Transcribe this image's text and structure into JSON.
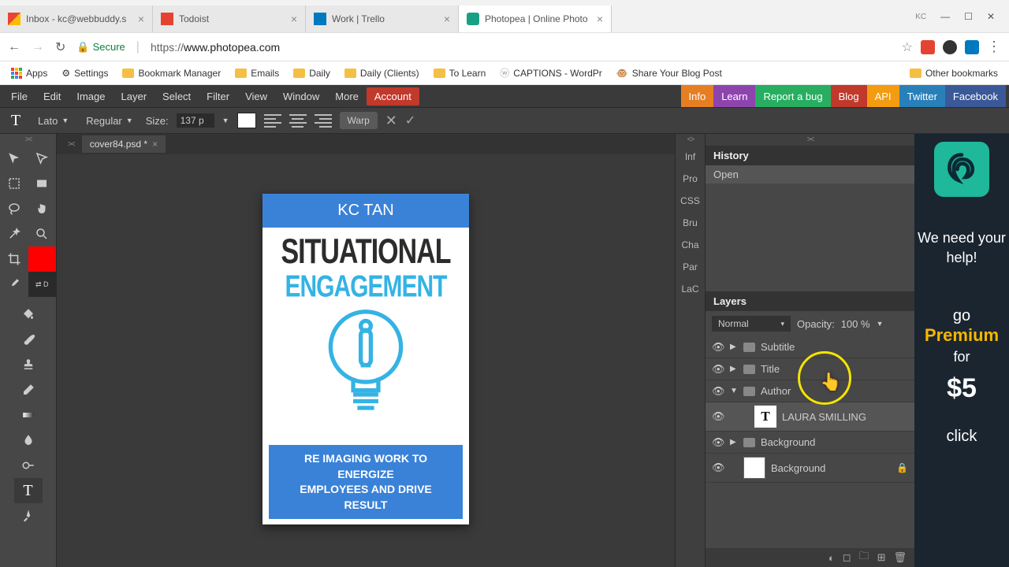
{
  "browser": {
    "tabs": [
      {
        "label": "Inbox - kc@webbuddy.s"
      },
      {
        "label": "Todoist"
      },
      {
        "label": "Work | Trello"
      },
      {
        "label": "Photopea | Online Photo"
      }
    ],
    "secure_label": "Secure",
    "url_prefix": "https://",
    "url_domain": "www.photopea.com",
    "user_badge": "KC"
  },
  "bookmarks": {
    "apps": "Apps",
    "settings": "Settings",
    "items": [
      "Bookmark Manager",
      "Emails",
      "Daily",
      "Daily (Clients)",
      "To Learn",
      "CAPTIONS - WordPr",
      "Share Your Blog Post"
    ],
    "other": "Other bookmarks"
  },
  "menubar": {
    "items": [
      "File",
      "Edit",
      "Image",
      "Layer",
      "Select",
      "Filter",
      "View",
      "Window",
      "More"
    ],
    "account": "Account",
    "right": [
      {
        "label": "Info",
        "bg": "#e67e22"
      },
      {
        "label": "Learn",
        "bg": "#8e44ad"
      },
      {
        "label": "Report a bug",
        "bg": "#27ae60"
      },
      {
        "label": "Blog",
        "bg": "#c0392b"
      },
      {
        "label": "API",
        "bg": "#f39c12"
      },
      {
        "label": "Twitter",
        "bg": "#2980b9"
      },
      {
        "label": "Facebook",
        "bg": "#34495e"
      }
    ]
  },
  "options": {
    "font": "Lato",
    "weight": "Regular",
    "size_label": "Size:",
    "size_value": "137 p",
    "warp": "Warp"
  },
  "doc_tab": "cover84.psd *",
  "book": {
    "author_top": "KC TAN",
    "title_l1": "SITUATIONAL",
    "title_l2": "ENGAGEMENT",
    "subtitle_l1": "RE IMAGING WORK TO ENERGIZE",
    "subtitle_l2": "EMPLOYEES AND DRIVE RESULT"
  },
  "side_tabs": [
    "Inf",
    "Pro",
    "CSS",
    "Bru",
    "Cha",
    "Par",
    "LaC"
  ],
  "history": {
    "title": "History",
    "item": "Open"
  },
  "layers": {
    "title": "Layers",
    "blend": "Normal",
    "opacity_label": "Opacity:",
    "opacity_value": "100 %",
    "items": {
      "subtitle": "Subtitle",
      "title_folder": "Title",
      "author": "Author",
      "text_layer": "LAURA SMILLING",
      "background_folder": "Background",
      "background_layer": "Background"
    }
  },
  "ad": {
    "line1": "We need your help!",
    "go": "go",
    "premium": "Premium",
    "for": "for",
    "price": "$5",
    "click": "click"
  }
}
